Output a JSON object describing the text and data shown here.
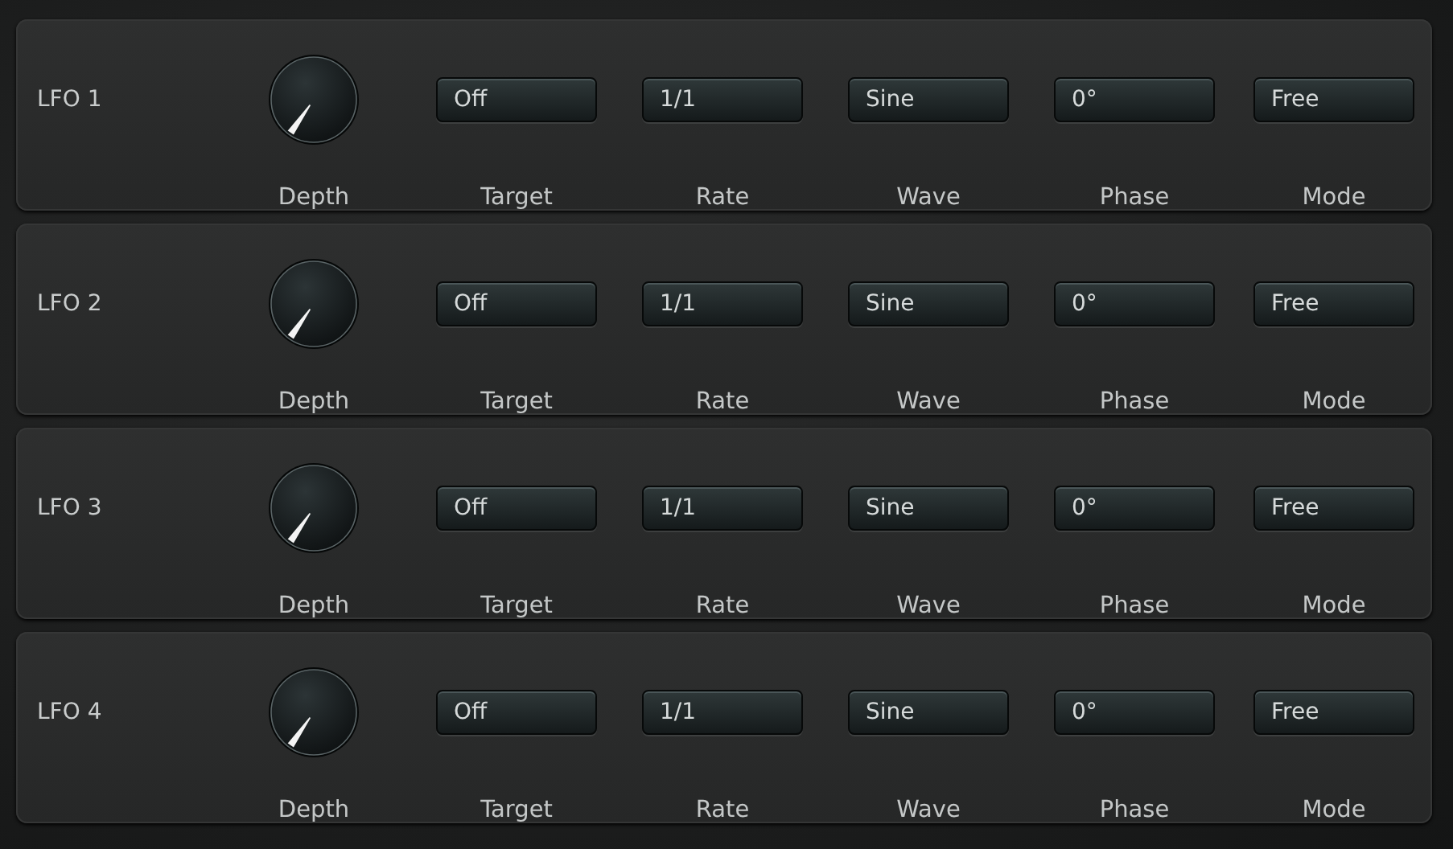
{
  "lfos": [
    {
      "label": "LFO 1",
      "depth": {
        "caption": "Depth"
      },
      "selectors": [
        {
          "value": "Off",
          "caption": "Target"
        },
        {
          "value": "1/1",
          "caption": "Rate"
        },
        {
          "value": "Sine",
          "caption": "Wave"
        },
        {
          "value": "0°",
          "caption": "Phase"
        },
        {
          "value": "Free",
          "caption": "Mode"
        }
      ]
    },
    {
      "label": "LFO 2",
      "depth": {
        "caption": "Depth"
      },
      "selectors": [
        {
          "value": "Off",
          "caption": "Target"
        },
        {
          "value": "1/1",
          "caption": "Rate"
        },
        {
          "value": "Sine",
          "caption": "Wave"
        },
        {
          "value": "0°",
          "caption": "Phase"
        },
        {
          "value": "Free",
          "caption": "Mode"
        }
      ]
    },
    {
      "label": "LFO 3",
      "depth": {
        "caption": "Depth"
      },
      "selectors": [
        {
          "value": "Off",
          "caption": "Target"
        },
        {
          "value": "1/1",
          "caption": "Rate"
        },
        {
          "value": "Sine",
          "caption": "Wave"
        },
        {
          "value": "0°",
          "caption": "Phase"
        },
        {
          "value": "Free",
          "caption": "Mode"
        }
      ]
    },
    {
      "label": "LFO 4",
      "depth": {
        "caption": "Depth"
      },
      "selectors": [
        {
          "value": "Off",
          "caption": "Target"
        },
        {
          "value": "1/1",
          "caption": "Rate"
        },
        {
          "value": "Sine",
          "caption": "Wave"
        },
        {
          "value": "0°",
          "caption": "Phase"
        },
        {
          "value": "Free",
          "caption": "Mode"
        }
      ]
    }
  ]
}
